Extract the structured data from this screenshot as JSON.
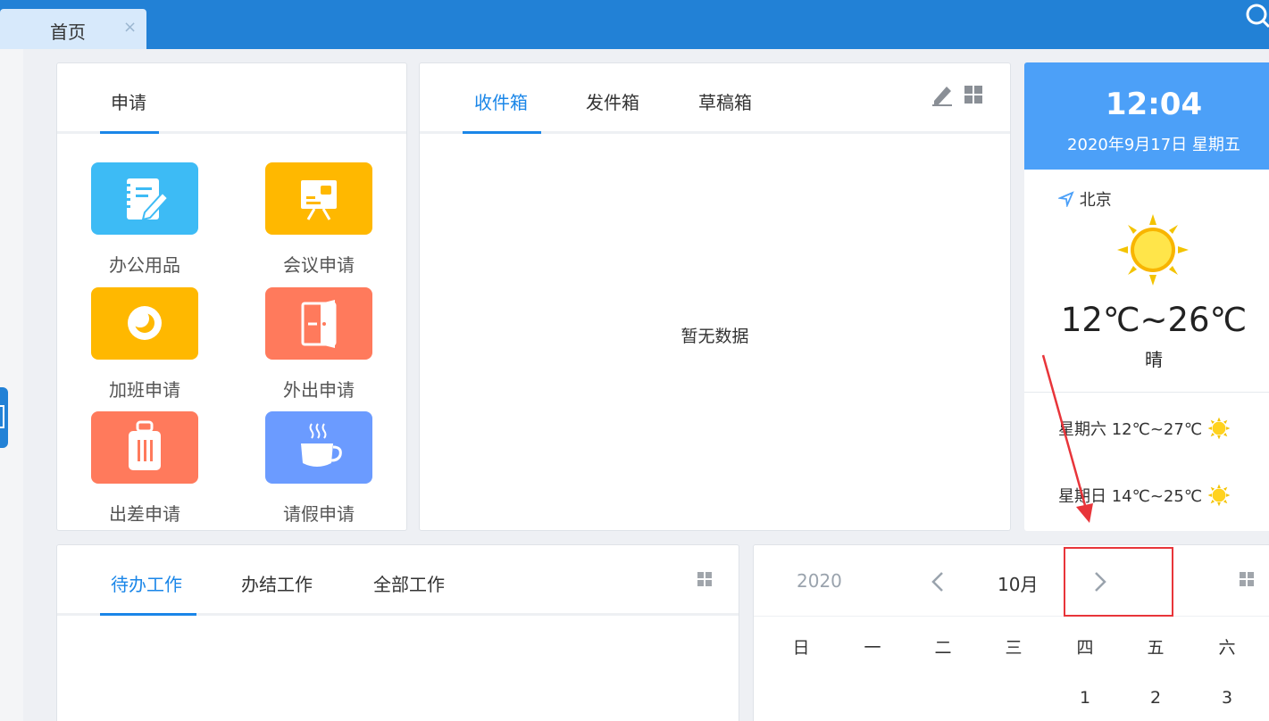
{
  "top_tab": {
    "label": "首页",
    "close": "×"
  },
  "apply": {
    "tab": "申请",
    "items": [
      {
        "label": "办公用品",
        "color": "#3dbbf5",
        "icon": "notebook-icon"
      },
      {
        "label": "会议申请",
        "color": "#ffb800",
        "icon": "presentation-icon"
      },
      {
        "label": "加班申请",
        "color": "#ffb800",
        "icon": "moon-icon"
      },
      {
        "label": "外出申请",
        "color": "#ff7a5c",
        "icon": "door-icon"
      },
      {
        "label": "出差申请",
        "color": "#ff7a5c",
        "icon": "luggage-icon"
      },
      {
        "label": "请假申请",
        "color": "#6b9bff",
        "icon": "coffee-icon"
      }
    ]
  },
  "mail": {
    "tabs": [
      "收件箱",
      "发件箱",
      "草稿箱"
    ],
    "active_tab": "收件箱",
    "empty_text": "暂无数据"
  },
  "weather": {
    "time": "12:04",
    "date": "2020年9月17日 星期五",
    "location": "北京",
    "temp_range": "12℃~26℃",
    "condition": "晴",
    "forecast": [
      {
        "text": "星期六 12℃~27℃"
      },
      {
        "text": "星期日 14℃~25℃"
      }
    ],
    "header_color": "#4ca0f8"
  },
  "work": {
    "tabs": [
      "待办工作",
      "办结工作",
      "全部工作"
    ],
    "active_tab": "待办工作"
  },
  "calendar": {
    "year": "2020",
    "month": "10月",
    "weekdays": [
      "日",
      "一",
      "二",
      "三",
      "四",
      "五",
      "六"
    ],
    "first_row_days": [
      "1",
      "2",
      "3"
    ]
  },
  "accent_color": "#1a86e8",
  "annotation_color": "#e8353a"
}
